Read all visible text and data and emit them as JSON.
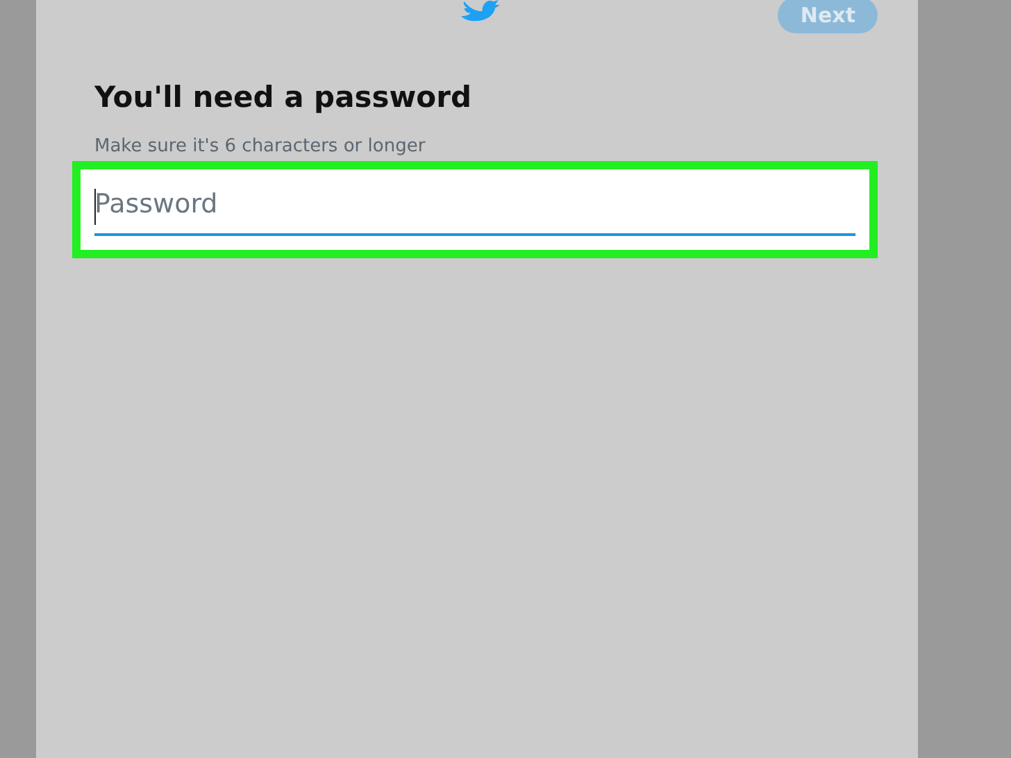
{
  "header": {
    "next_button": {
      "label": "Next",
      "disabled": true
    }
  },
  "title": "You'll need a password",
  "hint": "Make sure it's 6 characters or longer",
  "password_field": {
    "placeholder": "Password",
    "highlighted": true
  }
}
